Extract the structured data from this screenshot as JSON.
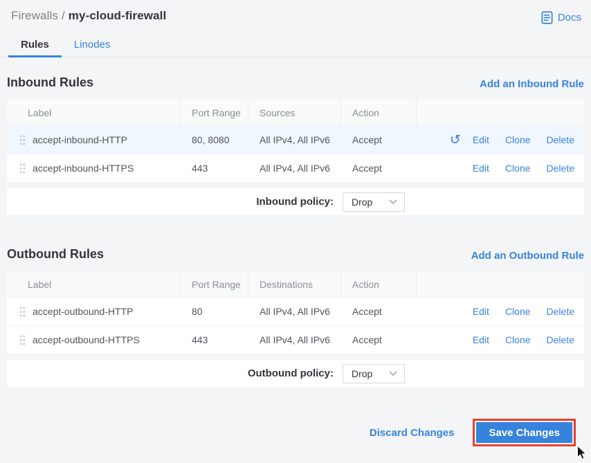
{
  "colors": {
    "accent_blue": "#3683dc",
    "save_outline_red": "#e8402c",
    "selected_row_bg": "#f1f7fe",
    "page_bg": "#f4f5f6"
  },
  "breadcrumb": {
    "root": "Firewalls",
    "separator": "/",
    "current": "my-cloud-firewall"
  },
  "header": {
    "docs_label": "Docs"
  },
  "tabs": {
    "rules": "Rules",
    "linodes": "Linodes"
  },
  "row_actions": {
    "edit": "Edit",
    "clone": "Clone",
    "delete": "Delete"
  },
  "icons": {
    "undo": "↺"
  },
  "inbound": {
    "title": "Inbound Rules",
    "add_rule_label": "Add an Inbound Rule",
    "columns": {
      "label": "Label",
      "port_range": "Port Range",
      "addresses": "Sources",
      "action": "Action"
    },
    "rows": [
      {
        "label": "accept-inbound-HTTP",
        "port_range": "80, 8080",
        "addresses": "All IPv4, All IPv6",
        "action": "Accept",
        "modified": true
      },
      {
        "label": "accept-inbound-HTTPS",
        "port_range": "443",
        "addresses": "All IPv4, All IPv6",
        "action": "Accept",
        "modified": false
      }
    ],
    "policy_label": "Inbound policy:",
    "policy_value": "Drop"
  },
  "outbound": {
    "title": "Outbound Rules",
    "add_rule_label": "Add an Outbound Rule",
    "columns": {
      "label": "Label",
      "port_range": "Port Range",
      "addresses": "Destinations",
      "action": "Action"
    },
    "rows": [
      {
        "label": "accept-outbound-HTTP",
        "port_range": "80",
        "addresses": "All IPv4, All IPv6",
        "action": "Accept",
        "modified": false
      },
      {
        "label": "accept-outbound-HTTPS",
        "port_range": "443",
        "addresses": "All IPv4, All IPv6",
        "action": "Accept",
        "modified": false
      }
    ],
    "policy_label": "Outbound policy:",
    "policy_value": "Drop"
  },
  "footer": {
    "discard_label": "Discard Changes",
    "save_label": "Save Changes"
  }
}
